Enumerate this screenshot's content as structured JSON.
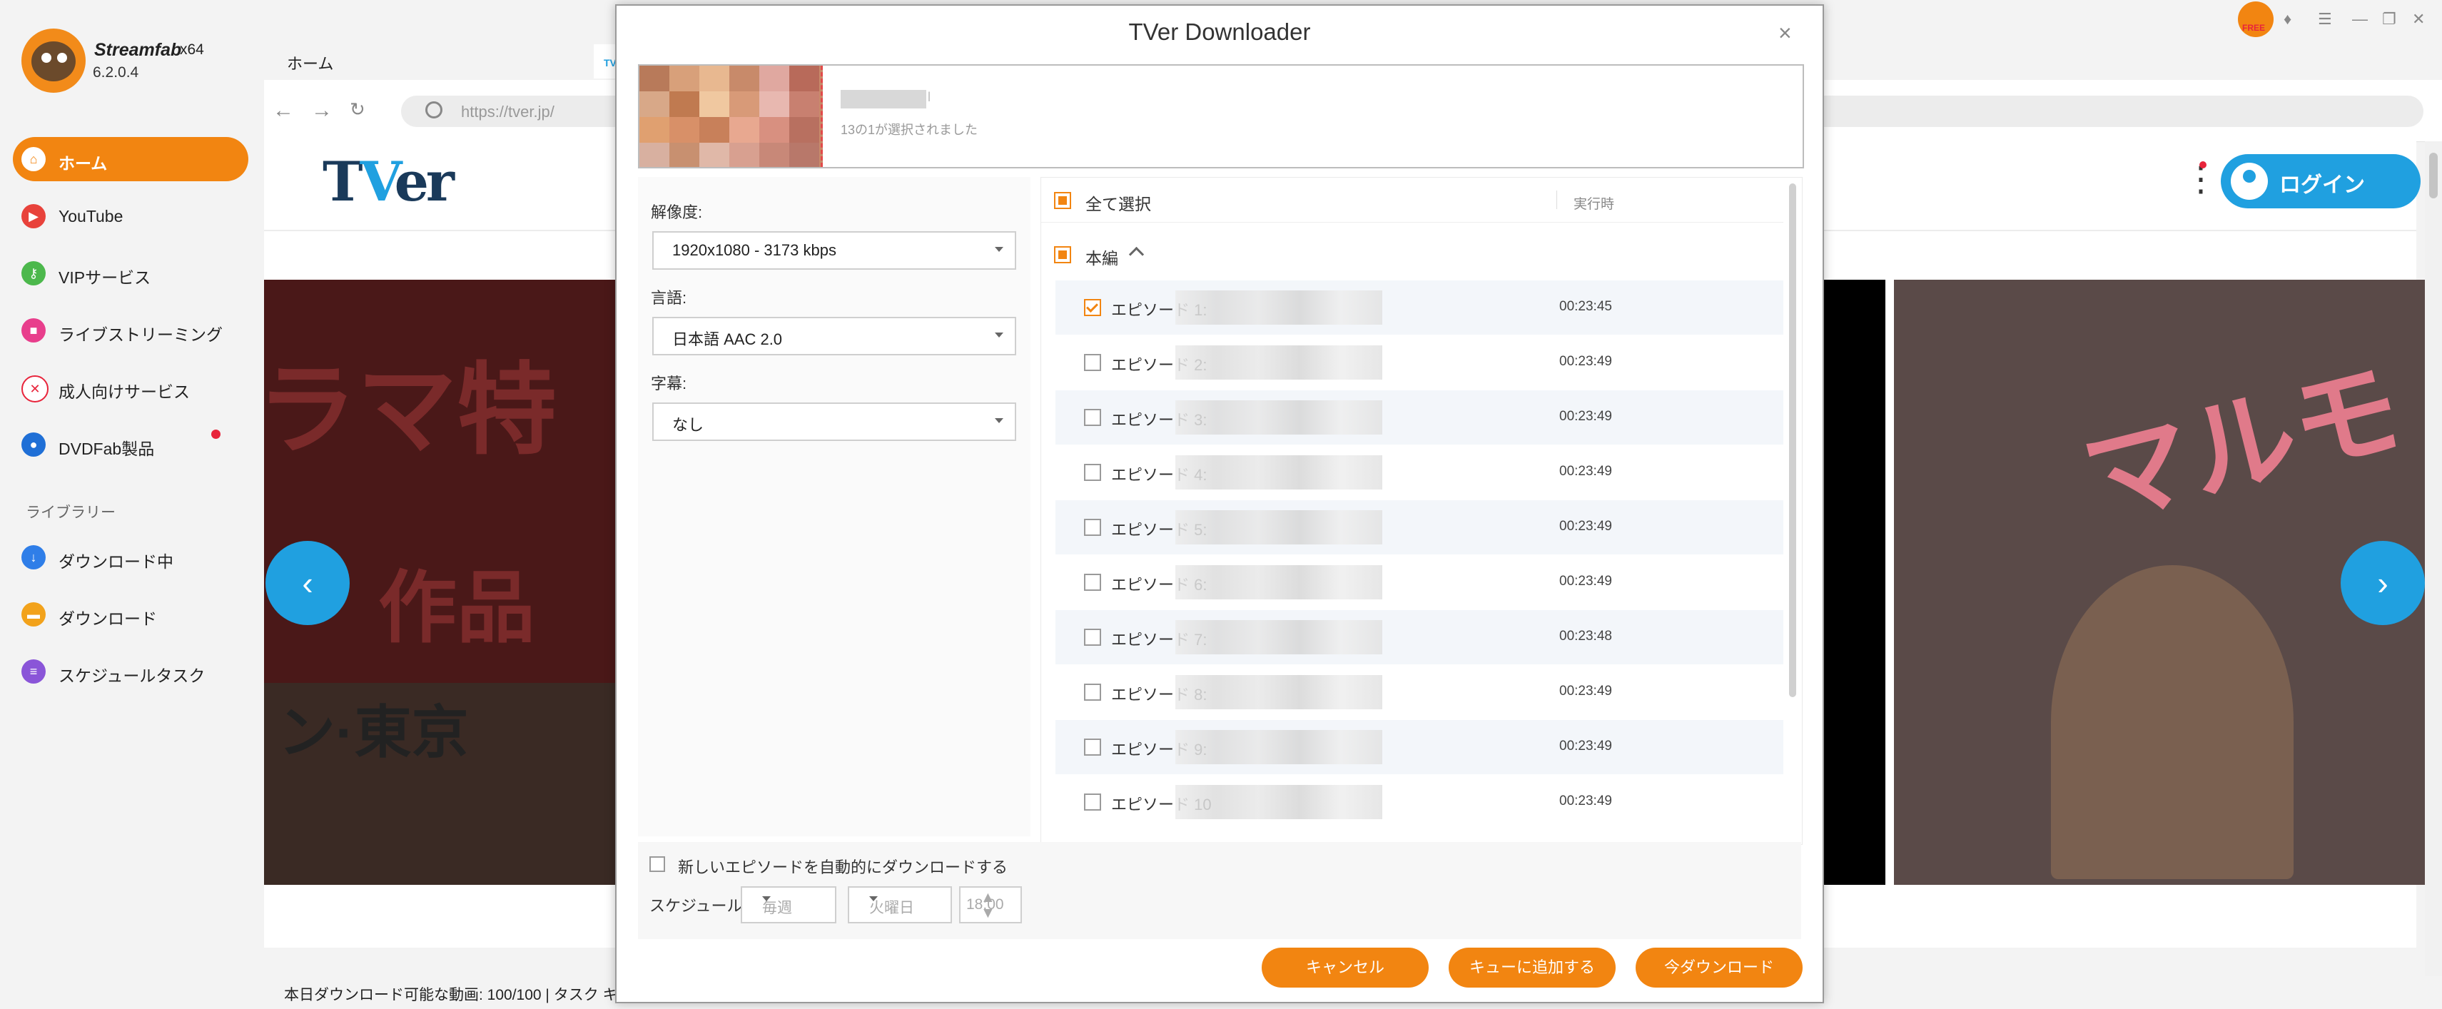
{
  "app": {
    "name": "Streamfab",
    "arch": "x64",
    "version": "6.2.0.4"
  },
  "sidebar": {
    "items": [
      {
        "label": "ホーム",
        "icon": "home-icon",
        "color": "#f28511"
      },
      {
        "label": "YouTube",
        "icon": "youtube-icon",
        "color": "#e8423b"
      },
      {
        "label": "VIPサービス",
        "icon": "key-icon",
        "color": "#4cb84c"
      },
      {
        "label": "ライブストリーミング",
        "icon": "camera-icon",
        "color": "#e83e8c"
      },
      {
        "label": "成人向けサービス",
        "icon": "adult-icon",
        "color": "#e8243b"
      },
      {
        "label": "DVDFab製品",
        "icon": "dvdfab-icon",
        "color": "#1f6fd6"
      }
    ],
    "library_title": "ライブラリー",
    "library_items": [
      {
        "label": "ダウンロード中",
        "icon": "download-arrow-icon",
        "color": "#2f7ee8"
      },
      {
        "label": "ダウンロード",
        "icon": "folder-icon",
        "color": "#f2a21b"
      },
      {
        "label": "スケジュールタスク",
        "icon": "schedule-list-icon",
        "color": "#8a55d8"
      }
    ]
  },
  "browser": {
    "home_tab": "ホーム",
    "tver_tab": "TV",
    "url": "https://tver.jp/",
    "window_controls": [
      "☰",
      "—",
      "❐",
      "✕"
    ]
  },
  "tver_page": {
    "logo_prefix": "T",
    "logo_v": "V",
    "logo_suffix": "er",
    "login": "ログイン",
    "banner_left_line1": "ラマ特",
    "banner_left_line2": "作品",
    "banner_left_line3": "ン·東京",
    "banner_right_text": "マルモ",
    "status_line": "本日ダウンロード可能な動画: 100/100 | タスク キ"
  },
  "dialog": {
    "title": "TVer Downloader",
    "title_fragment": "l",
    "selection_count": "13の1が選択されました",
    "resolution_label": "解像度:",
    "resolution_value": "1920x1080 - 3173 kbps",
    "language_label": "言語:",
    "language_value": "日本語 AAC 2.0",
    "subtitle_label": "字幕:",
    "subtitle_value": "なし",
    "select_all": "全て選択",
    "runtime_header": "実行時",
    "group_name": "本編",
    "episodes": [
      {
        "label": "エピソード 1:",
        "time": "00:23:45",
        "checked": true
      },
      {
        "label": "エピソード 2:",
        "time": "00:23:49",
        "checked": false
      },
      {
        "label": "エピソード 3:",
        "time": "00:23:49",
        "checked": false
      },
      {
        "label": "エピソード 4:",
        "time": "00:23:49",
        "checked": false
      },
      {
        "label": "エピソード 5:",
        "time": "00:23:49",
        "checked": false
      },
      {
        "label": "エピソード 6:",
        "time": "00:23:49",
        "checked": false
      },
      {
        "label": "エピソード 7:",
        "time": "00:23:48",
        "checked": false
      },
      {
        "label": "エピソード 8:",
        "time": "00:23:49",
        "checked": false
      },
      {
        "label": "エピソード 9:",
        "time": "00:23:49",
        "checked": false
      },
      {
        "label": "エピソード 10",
        "time": "00:23:49",
        "checked": false
      }
    ],
    "auto_download": "新しいエピソードを自動的にダウンロードする",
    "schedule_label": "スケジュール:",
    "schedule_frequency": "毎週",
    "schedule_day": "火曜日",
    "schedule_time": "18:00",
    "cancel": "キャンセル",
    "add_queue": "キューに追加する",
    "download_now": "今ダウンロード"
  }
}
